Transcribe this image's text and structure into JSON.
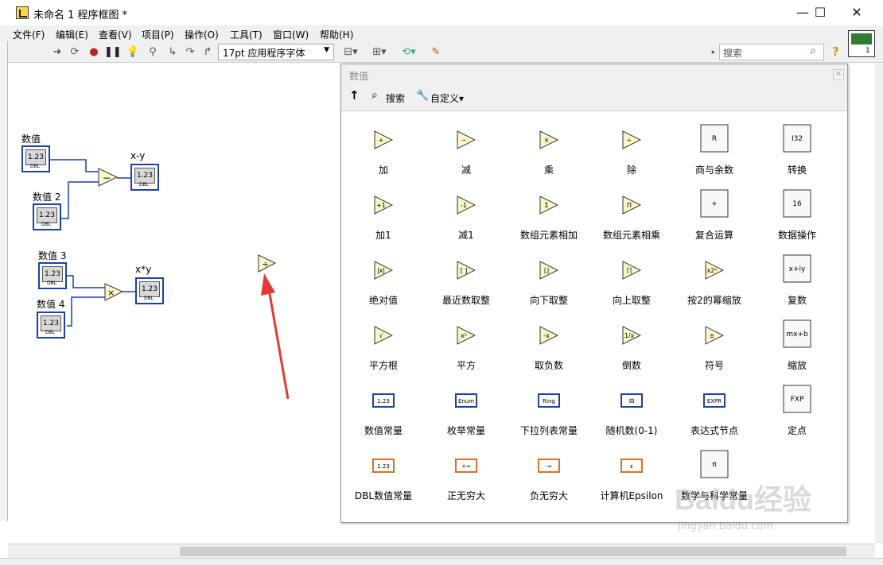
{
  "window": {
    "title": "未命名 1 程序框图 *",
    "minimize": "—",
    "maximize": "☐",
    "close": "✕"
  },
  "menu": [
    "文件(F)",
    "编辑(E)",
    "查看(V)",
    "项目(P)",
    "操作(O)",
    "工具(T)",
    "窗口(W)",
    "帮助(H)"
  ],
  "toolbar": {
    "font": "17pt 应用程序字体",
    "search_placeholder": "搜索",
    "vi_icon_number": "1"
  },
  "diagram": {
    "labels": {
      "num1": "数值",
      "num2": "数值 2",
      "num3": "数值 3",
      "num4": "数值 4",
      "out_sub": "x-y",
      "out_mul": "x*y"
    },
    "terminal_value": "1.23",
    "terminal_type": "DBL",
    "sub_symbol": "−",
    "mul_symbol": "×",
    "div_symbol": "÷"
  },
  "palette": {
    "title": "数值",
    "up_label": "↑",
    "search_label": "搜索",
    "customize_label": "自定义▾",
    "items": [
      {
        "label": "加",
        "icon": "add-icon",
        "glyph": "+"
      },
      {
        "label": "减",
        "icon": "subtract-icon",
        "glyph": "−"
      },
      {
        "label": "乘",
        "icon": "multiply-icon",
        "glyph": "×"
      },
      {
        "label": "除",
        "icon": "divide-icon",
        "glyph": "÷"
      },
      {
        "label": "商与余数",
        "icon": "quotient-remainder-icon",
        "glyph": "R"
      },
      {
        "label": "转换",
        "icon": "conversion-icon",
        "glyph": "I32"
      },
      {
        "label": "加1",
        "icon": "increment-icon",
        "glyph": "+1"
      },
      {
        "label": "减1",
        "icon": "decrement-icon",
        "glyph": "-1"
      },
      {
        "label": "数组元素相加",
        "icon": "add-array-elements-icon",
        "glyph": "Σ"
      },
      {
        "label": "数组元素相乘",
        "icon": "multiply-array-elements-icon",
        "glyph": "Π"
      },
      {
        "label": "复合运算",
        "icon": "compound-arithmetic-icon",
        "glyph": "+"
      },
      {
        "label": "数据操作",
        "icon": "data-manipulation-icon",
        "glyph": "16"
      },
      {
        "label": "绝对值",
        "icon": "absolute-value-icon",
        "glyph": "|x|"
      },
      {
        "label": "最近数取整",
        "icon": "round-nearest-icon",
        "glyph": "[ ]"
      },
      {
        "label": "向下取整",
        "icon": "round-down-icon",
        "glyph": "⌊⌋"
      },
      {
        "label": "向上取整",
        "icon": "round-up-icon",
        "glyph": "⌈⌉"
      },
      {
        "label": "按2的幂缩放",
        "icon": "scale-power-of-2-icon",
        "glyph": "x2ⁿ"
      },
      {
        "label": "复数",
        "icon": "complex-icon",
        "glyph": "x+iy"
      },
      {
        "label": "平方根",
        "icon": "square-root-icon",
        "glyph": "√"
      },
      {
        "label": "平方",
        "icon": "square-icon",
        "glyph": "x²"
      },
      {
        "label": "取负数",
        "icon": "negate-icon",
        "glyph": "-x"
      },
      {
        "label": "倒数",
        "icon": "reciprocal-icon",
        "glyph": "1/x"
      },
      {
        "label": "符号",
        "icon": "sign-icon",
        "glyph": "±"
      },
      {
        "label": "缩放",
        "icon": "scaling-icon",
        "glyph": "mx+b"
      },
      {
        "label": "数值常量",
        "icon": "numeric-constant-icon",
        "glyph": "1.23"
      },
      {
        "label": "枚举常量",
        "icon": "enum-constant-icon",
        "glyph": "Enum"
      },
      {
        "label": "下拉列表常量",
        "icon": "ring-constant-icon",
        "glyph": "Ring"
      },
      {
        "label": "随机数(0-1)",
        "icon": "random-number-icon",
        "glyph": "⚄"
      },
      {
        "label": "表达式节点",
        "icon": "expression-node-icon",
        "glyph": "EXPR"
      },
      {
        "label": "定点",
        "icon": "fixed-point-icon",
        "glyph": "FXP"
      },
      {
        "label": "DBL数值常量",
        "icon": "dbl-constant-icon",
        "glyph": "1.23"
      },
      {
        "label": "正无穷大",
        "icon": "positive-infinity-icon",
        "glyph": "+∞"
      },
      {
        "label": "负无穷大",
        "icon": "negative-infinity-icon",
        "glyph": "-∞"
      },
      {
        "label": "计算机Epsilon",
        "icon": "machine-epsilon-icon",
        "glyph": "ε"
      },
      {
        "label": "数学与科学常量",
        "icon": "math-constants-icon",
        "glyph": "π"
      }
    ]
  },
  "watermark": {
    "logo": "Baidu经验",
    "url": "jingyan.baidu.com"
  },
  "colors": {
    "wire": "#1a3fb5",
    "node_fill": "#fbf6c8",
    "arrow": "#e53935",
    "dbl_orange": "#e07020"
  }
}
